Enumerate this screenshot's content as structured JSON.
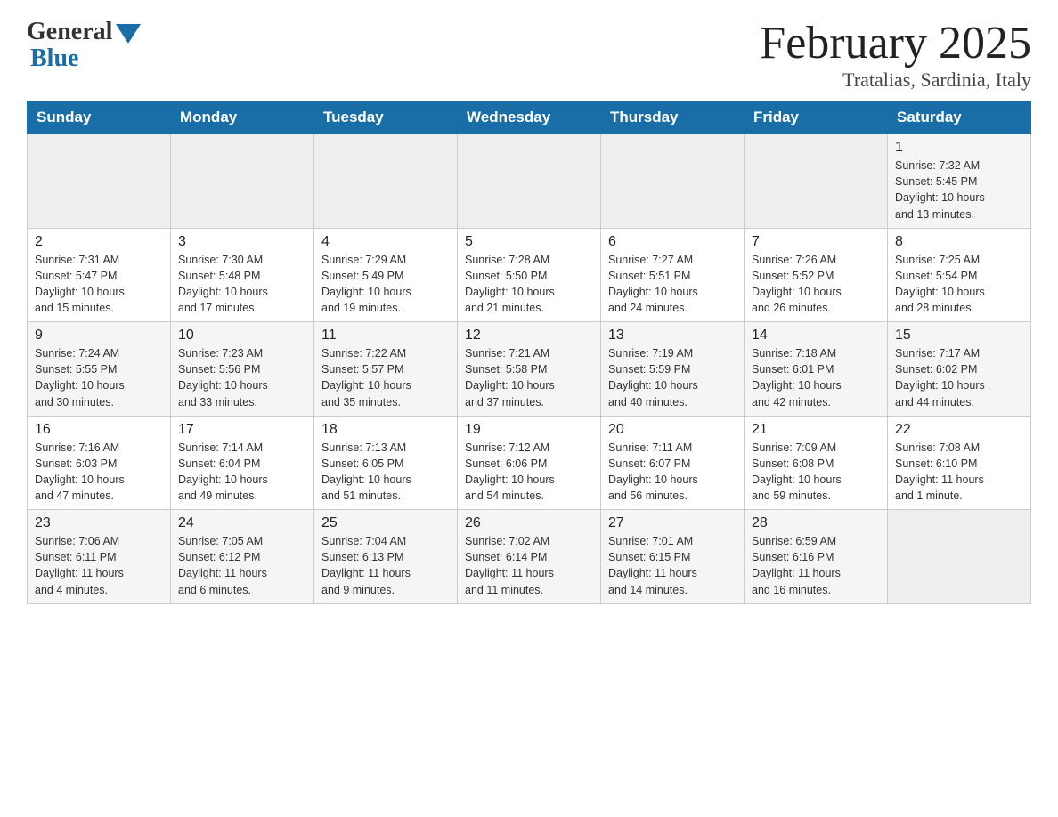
{
  "header": {
    "logo_general": "General",
    "logo_blue": "Blue",
    "month_title": "February 2025",
    "location": "Tratalias, Sardinia, Italy"
  },
  "days_of_week": [
    "Sunday",
    "Monday",
    "Tuesday",
    "Wednesday",
    "Thursday",
    "Friday",
    "Saturday"
  ],
  "weeks": [
    {
      "days": [
        {
          "num": "",
          "info": ""
        },
        {
          "num": "",
          "info": ""
        },
        {
          "num": "",
          "info": ""
        },
        {
          "num": "",
          "info": ""
        },
        {
          "num": "",
          "info": ""
        },
        {
          "num": "",
          "info": ""
        },
        {
          "num": "1",
          "info": "Sunrise: 7:32 AM\nSunset: 5:45 PM\nDaylight: 10 hours\nand 13 minutes."
        }
      ]
    },
    {
      "days": [
        {
          "num": "2",
          "info": "Sunrise: 7:31 AM\nSunset: 5:47 PM\nDaylight: 10 hours\nand 15 minutes."
        },
        {
          "num": "3",
          "info": "Sunrise: 7:30 AM\nSunset: 5:48 PM\nDaylight: 10 hours\nand 17 minutes."
        },
        {
          "num": "4",
          "info": "Sunrise: 7:29 AM\nSunset: 5:49 PM\nDaylight: 10 hours\nand 19 minutes."
        },
        {
          "num": "5",
          "info": "Sunrise: 7:28 AM\nSunset: 5:50 PM\nDaylight: 10 hours\nand 21 minutes."
        },
        {
          "num": "6",
          "info": "Sunrise: 7:27 AM\nSunset: 5:51 PM\nDaylight: 10 hours\nand 24 minutes."
        },
        {
          "num": "7",
          "info": "Sunrise: 7:26 AM\nSunset: 5:52 PM\nDaylight: 10 hours\nand 26 minutes."
        },
        {
          "num": "8",
          "info": "Sunrise: 7:25 AM\nSunset: 5:54 PM\nDaylight: 10 hours\nand 28 minutes."
        }
      ]
    },
    {
      "days": [
        {
          "num": "9",
          "info": "Sunrise: 7:24 AM\nSunset: 5:55 PM\nDaylight: 10 hours\nand 30 minutes."
        },
        {
          "num": "10",
          "info": "Sunrise: 7:23 AM\nSunset: 5:56 PM\nDaylight: 10 hours\nand 33 minutes."
        },
        {
          "num": "11",
          "info": "Sunrise: 7:22 AM\nSunset: 5:57 PM\nDaylight: 10 hours\nand 35 minutes."
        },
        {
          "num": "12",
          "info": "Sunrise: 7:21 AM\nSunset: 5:58 PM\nDaylight: 10 hours\nand 37 minutes."
        },
        {
          "num": "13",
          "info": "Sunrise: 7:19 AM\nSunset: 5:59 PM\nDaylight: 10 hours\nand 40 minutes."
        },
        {
          "num": "14",
          "info": "Sunrise: 7:18 AM\nSunset: 6:01 PM\nDaylight: 10 hours\nand 42 minutes."
        },
        {
          "num": "15",
          "info": "Sunrise: 7:17 AM\nSunset: 6:02 PM\nDaylight: 10 hours\nand 44 minutes."
        }
      ]
    },
    {
      "days": [
        {
          "num": "16",
          "info": "Sunrise: 7:16 AM\nSunset: 6:03 PM\nDaylight: 10 hours\nand 47 minutes."
        },
        {
          "num": "17",
          "info": "Sunrise: 7:14 AM\nSunset: 6:04 PM\nDaylight: 10 hours\nand 49 minutes."
        },
        {
          "num": "18",
          "info": "Sunrise: 7:13 AM\nSunset: 6:05 PM\nDaylight: 10 hours\nand 51 minutes."
        },
        {
          "num": "19",
          "info": "Sunrise: 7:12 AM\nSunset: 6:06 PM\nDaylight: 10 hours\nand 54 minutes."
        },
        {
          "num": "20",
          "info": "Sunrise: 7:11 AM\nSunset: 6:07 PM\nDaylight: 10 hours\nand 56 minutes."
        },
        {
          "num": "21",
          "info": "Sunrise: 7:09 AM\nSunset: 6:08 PM\nDaylight: 10 hours\nand 59 minutes."
        },
        {
          "num": "22",
          "info": "Sunrise: 7:08 AM\nSunset: 6:10 PM\nDaylight: 11 hours\nand 1 minute."
        }
      ]
    },
    {
      "days": [
        {
          "num": "23",
          "info": "Sunrise: 7:06 AM\nSunset: 6:11 PM\nDaylight: 11 hours\nand 4 minutes."
        },
        {
          "num": "24",
          "info": "Sunrise: 7:05 AM\nSunset: 6:12 PM\nDaylight: 11 hours\nand 6 minutes."
        },
        {
          "num": "25",
          "info": "Sunrise: 7:04 AM\nSunset: 6:13 PM\nDaylight: 11 hours\nand 9 minutes."
        },
        {
          "num": "26",
          "info": "Sunrise: 7:02 AM\nSunset: 6:14 PM\nDaylight: 11 hours\nand 11 minutes."
        },
        {
          "num": "27",
          "info": "Sunrise: 7:01 AM\nSunset: 6:15 PM\nDaylight: 11 hours\nand 14 minutes."
        },
        {
          "num": "28",
          "info": "Sunrise: 6:59 AM\nSunset: 6:16 PM\nDaylight: 11 hours\nand 16 minutes."
        },
        {
          "num": "",
          "info": ""
        }
      ]
    }
  ]
}
